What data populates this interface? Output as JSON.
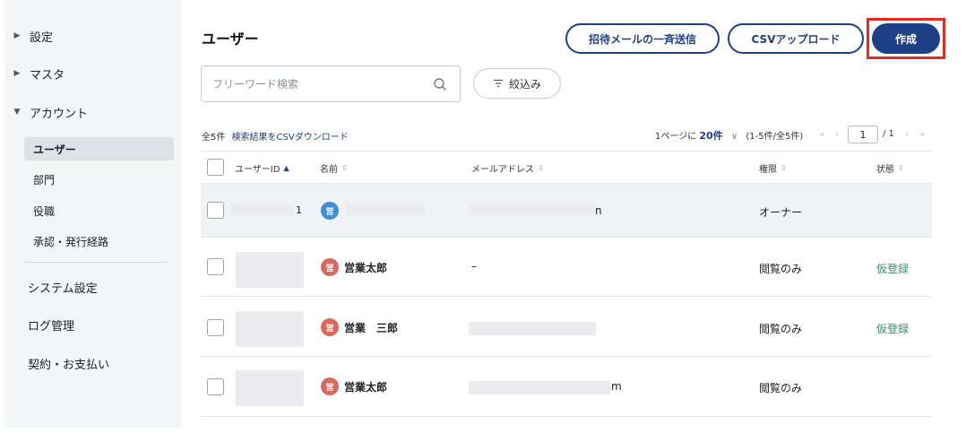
{
  "sidebar": {
    "groups": [
      {
        "label": "設定",
        "expanded": false
      },
      {
        "label": "マスタ",
        "expanded": false
      },
      {
        "label": "アカウント",
        "expanded": true
      }
    ],
    "sub_items": [
      "ユーザー",
      "部門",
      "役職",
      "承認・発行経路"
    ],
    "active_sub": "ユーザー",
    "top_items": [
      "システム設定",
      "ログ管理",
      "契約・お支払い"
    ]
  },
  "header": {
    "title": "ユーザー",
    "invite_button": "招待メールの一斉送信",
    "csv_upload_button": "CSVアップロード",
    "create_button": "作成"
  },
  "search": {
    "placeholder": "フリーワード検索",
    "value": ""
  },
  "filter": {
    "label": "絞込み"
  },
  "table_meta": {
    "total": "全5件",
    "csv_download_link": "検索結果をCSVダウンロード",
    "per_page_prefix": "1ページに",
    "per_page_value": "20件",
    "range": "(1-5件/全5件)",
    "page_current": "1",
    "page_total": "/ 1"
  },
  "table": {
    "columns": [
      "ユーザーID",
      "名前",
      "メールアドレス",
      "権限",
      "状態"
    ],
    "rows": [
      {
        "id_suffix": "1",
        "avatar": "営",
        "avatar_color": "#3f8fd4",
        "name": "",
        "email_suffix": "n",
        "role": "オーナー",
        "status": ""
      },
      {
        "id_suffix": "",
        "avatar": "営",
        "avatar_color": "#d9695f",
        "name": "営業太郎",
        "email_suffix": "–",
        "role": "閲覧のみ",
        "status": "仮登録"
      },
      {
        "id_suffix": "",
        "avatar": "営",
        "avatar_color": "#d9695f",
        "name": "営業　三郎",
        "email_suffix": "",
        "role": "閲覧のみ",
        "status": "仮登録"
      },
      {
        "id_suffix": "",
        "avatar": "営",
        "avatar_color": "#d9695f",
        "name": "営業太郎",
        "email_suffix": "m",
        "role": "閲覧のみ",
        "status": ""
      }
    ]
  },
  "colors": {
    "brand": "#1f3f86",
    "highlight": "#e8291f",
    "status_green": "#3a8a6a"
  }
}
